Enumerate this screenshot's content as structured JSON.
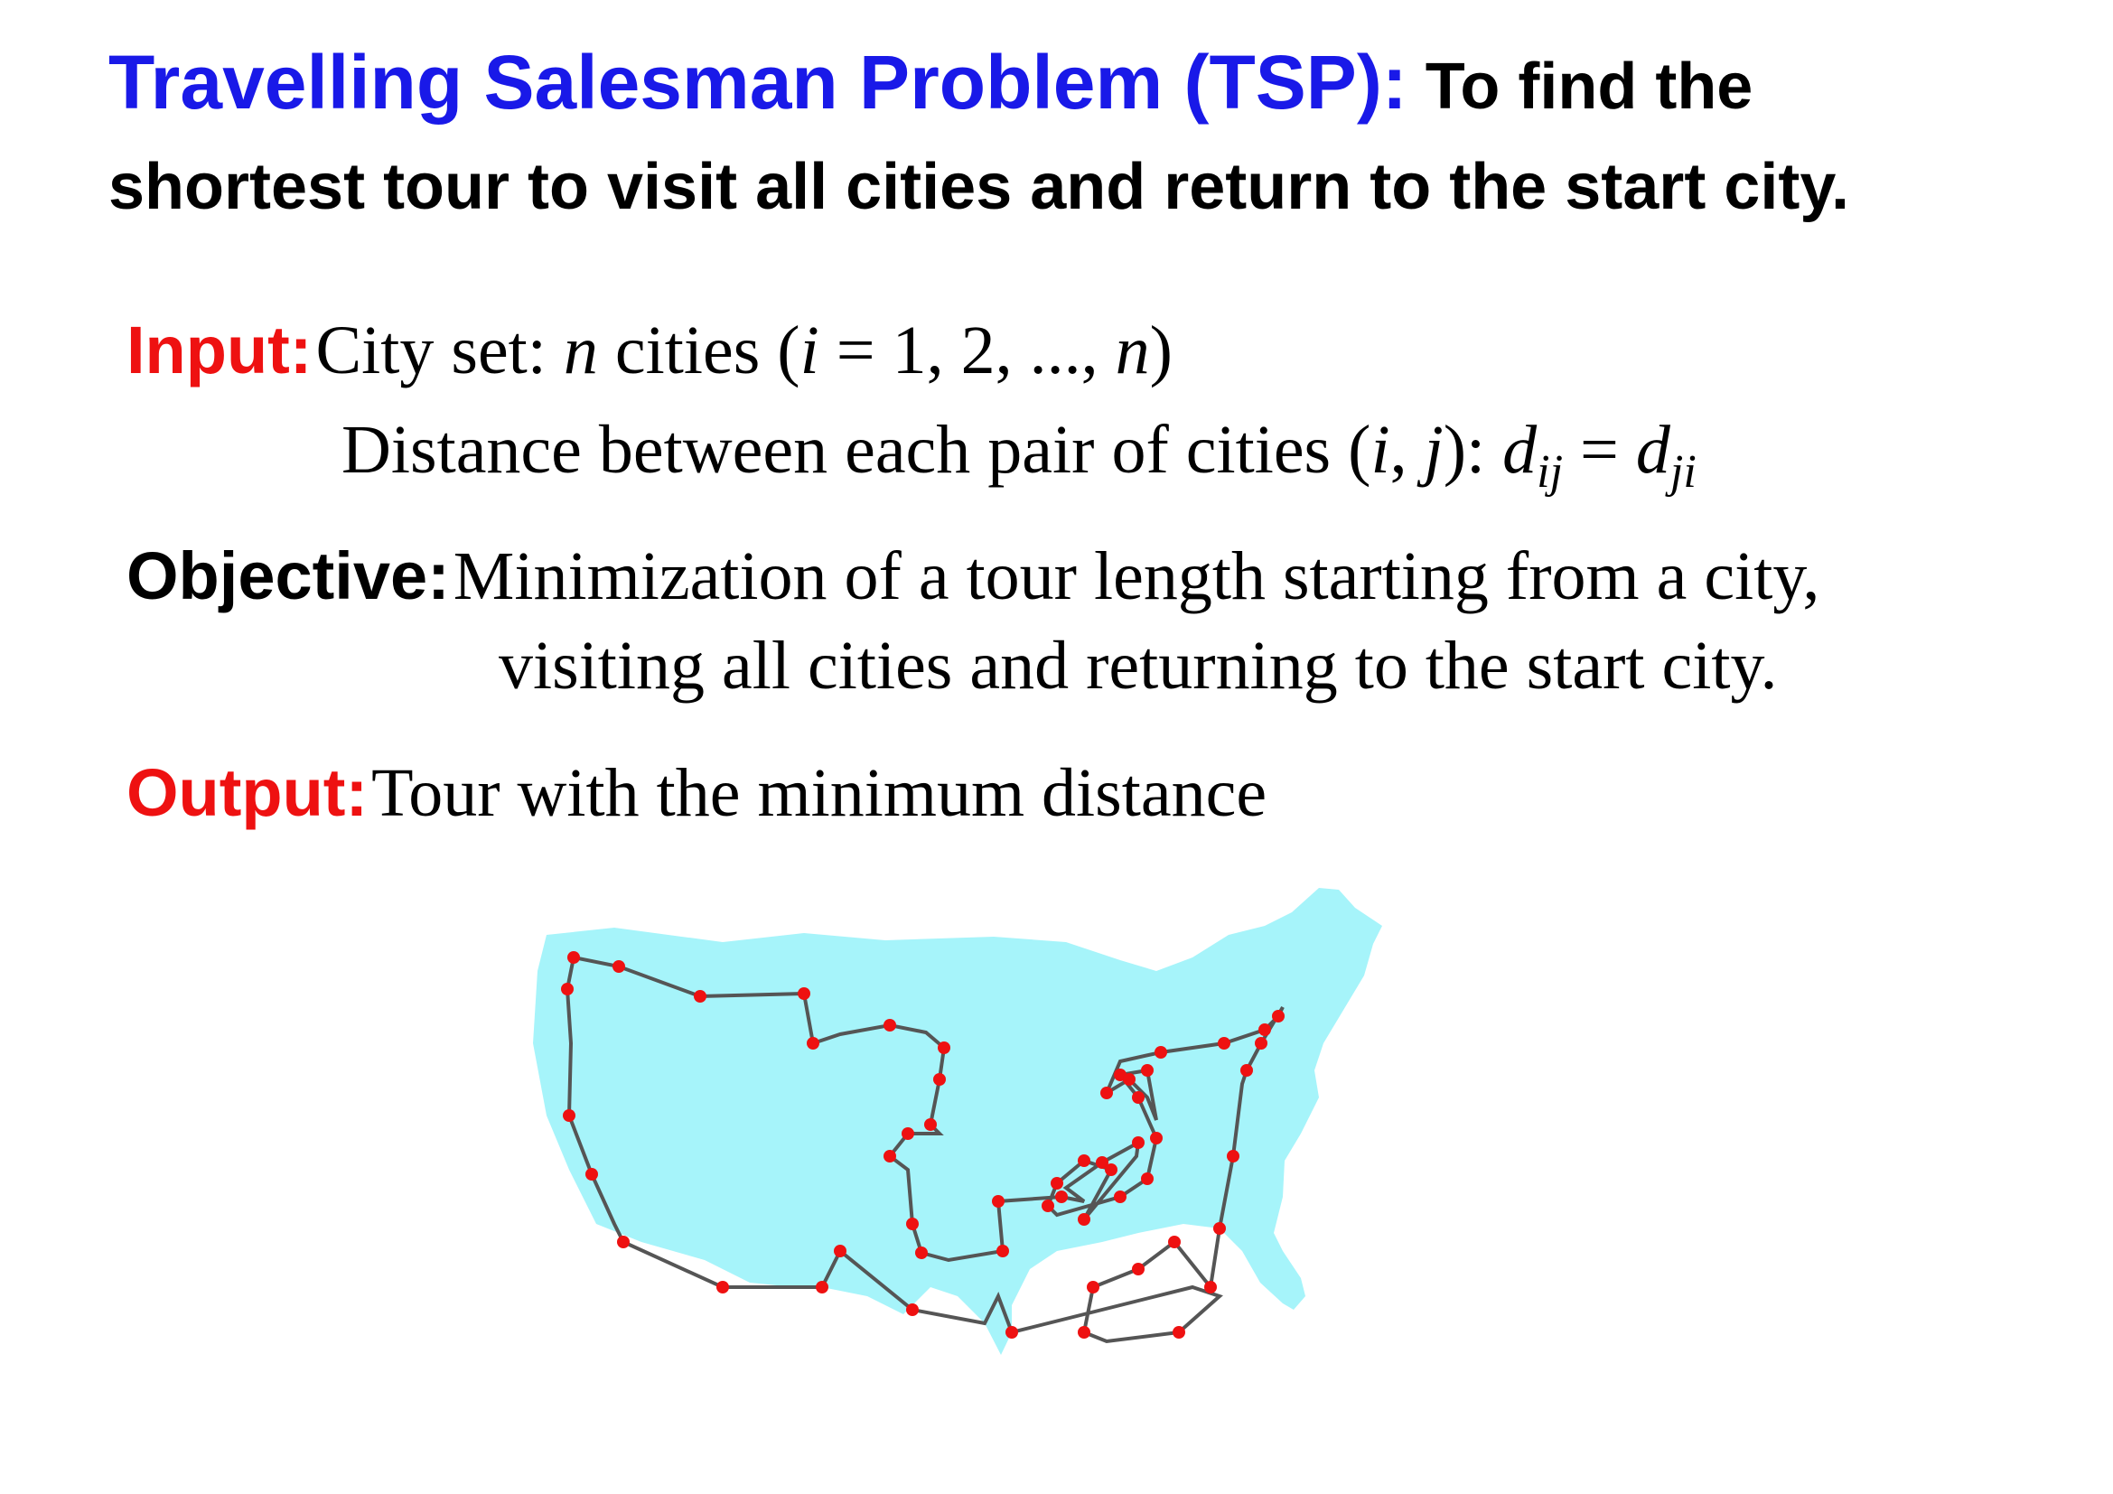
{
  "title": {
    "heading": "Travelling  Salesman Problem (TSP):",
    "subheading_line1": " To find the",
    "subheading_line2": "shortest tour to visit all cities and return to the start city."
  },
  "input": {
    "label": "Input:",
    "line1_a": "City set: ",
    "line1_n": "n",
    "line1_b": " cities (",
    "line1_i": "i",
    "line1_c": " = 1, 2, ..., ",
    "line1_n2": "n",
    "line1_d": ")",
    "line2_a": "Distance between each pair of cities (",
    "line2_i": "i",
    "line2_comma": ", ",
    "line2_j": "j",
    "line2_b": "):  ",
    "d1": "d",
    "d1_sub": "ij",
    "eq": " = ",
    "d2": "d",
    "d2_sub": "ji"
  },
  "objective": {
    "label": "Objective:",
    "line1": " Minimization of a tour length starting from a city,",
    "line2": "visiting all cities and returning to the start city."
  },
  "output": {
    "label": "Output:",
    "text": " Tour with the minimum distance"
  },
  "colors": {
    "heading": "#1919e8",
    "label_red": "#ee1111",
    "map_fill": "#a6f4fa",
    "tour_line": "#555555",
    "city_dot": "#ee1111"
  }
}
